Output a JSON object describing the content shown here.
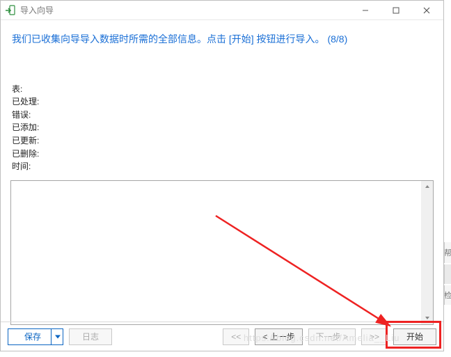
{
  "window": {
    "title": "导入向导"
  },
  "headline": "我们已收集向导导入数据时所需的全部信息。点击 [开始] 按钮进行导入。 (8/8)",
  "info": {
    "table_label": "表:",
    "processed_label": "已处理:",
    "error_label": "错误:",
    "added_label": "已添加:",
    "updated_label": "已更新:",
    "deleted_label": "已删除:",
    "time_label": "时间:"
  },
  "buttons": {
    "save": "保存",
    "log": "日志",
    "first": "<<",
    "prev": "< 上一步",
    "next": "下一步 >",
    "last": ">>",
    "start": "开始"
  },
  "watermark": "https://blog.csdn.net/Amelia__Liu"
}
